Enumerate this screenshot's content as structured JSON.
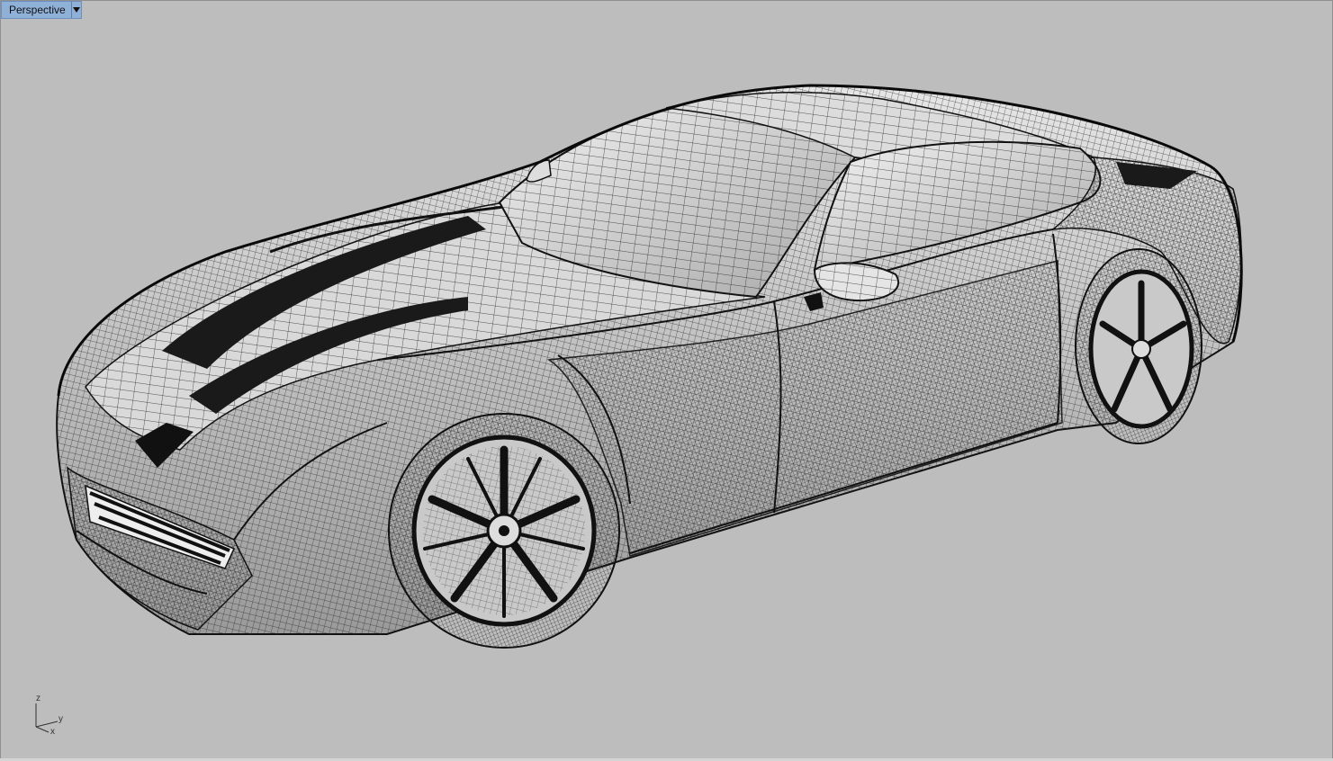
{
  "viewport": {
    "name": "Perspective",
    "dropdown_icon": "triangle-down-icon",
    "background": "#bdbdbd",
    "tab_color": "#8fb1d8",
    "wire_color": "#111111"
  },
  "axes": {
    "z": "z",
    "y": "y",
    "x": "x"
  },
  "model": {
    "display_mode": "wireframe",
    "subject": "sports car"
  }
}
